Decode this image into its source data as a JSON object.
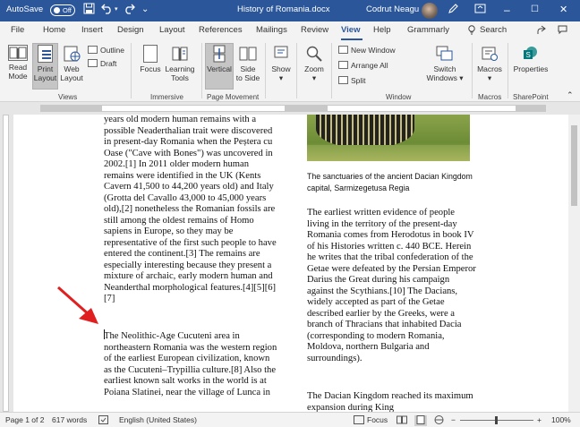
{
  "titlebar": {
    "autosave_label": "AutoSave",
    "autosave_state": "Off",
    "document_title": "History of Romania.docx",
    "user_name": "Codrut Neagu",
    "save_icon": "save-icon",
    "undo_icon": "undo-icon",
    "redo_icon": "redo-icon",
    "minimize": "–",
    "maximize": "☐",
    "close": "✕"
  },
  "tabs": [
    "File",
    "Home",
    "Insert",
    "Design",
    "Layout",
    "References",
    "Mailings",
    "Review",
    "View",
    "Help",
    "Grammarly"
  ],
  "active_tab": "View",
  "search_label": "Search",
  "ribbon": {
    "views": {
      "group": "Views",
      "read_mode": [
        "Read",
        "Mode"
      ],
      "print_layout": [
        "Print",
        "Layout"
      ],
      "web_layout": [
        "Web",
        "Layout"
      ],
      "outline": "Outline",
      "draft": "Draft"
    },
    "immersive": {
      "group": "Immersive",
      "focus": "Focus",
      "learning_tools": [
        "Learning",
        "Tools"
      ]
    },
    "page_movement": {
      "group": "Page Movement",
      "vertical": "Vertical",
      "side_to_side": [
        "Side",
        "to Side"
      ]
    },
    "show": "Show",
    "zoom": "Zoom",
    "window": {
      "group": "Window",
      "new_window": "New Window",
      "arrange_all": "Arrange All",
      "split": "Split",
      "switch_windows": [
        "Switch",
        "Windows ▾"
      ]
    },
    "macros": {
      "group": "Macros",
      "label": "Macros"
    },
    "sharepoint": {
      "group": "SharePoint",
      "label": "Properties"
    }
  },
  "document": {
    "left_col_top": "years old modern human remains with a possible Neaderthalian trait were discovered in present-day Romania when the Peștera cu Oase (\"Cave with Bones\") was uncovered in 2002.[1] In 2011 older modern human remains were identified in the UK (Kents Cavern 41,500 to 44,200 years old) and Italy (Grotta del Cavallo 43,000 to 45,000 years old),[2] nonetheless the Romanian fossils are still among the oldest remains of Homo sapiens in Europe, so they may be representative of the first such people to have entered the continent.[3] The remains are especially interesting because they present a mixture of archaic, early modern human and Neanderthal morphological features.[4][5][6][7]",
    "left_col_bottom": "The Neolithic-Age Cucuteni area in northeastern Romania was the western region of the earliest European civilization, known as the Cucuteni–Trypillia culture.[8] Also the earliest known salt works in the world is at Poiana Slatinei, near the village of Lunca in",
    "caption": "The sanctuaries of the ancient Dacian Kingdom capital, Sarmizegetusa Regia",
    "right_col_para1": "The earliest written evidence of people living in the territory of the present-day Romania comes from Herodotus in book IV of his Histories written c. 440 BCE. Herein he writes that the tribal confederation of the Getae were defeated by the Persian Emperor Darius the Great during his campaign against the Scythians.[10] The Dacians, widely accepted as part of the Getae described earlier by the Greeks, were a branch of Thracians that inhabited Dacia (corresponding to modern Romania, Moldova, northern Bulgaria and surroundings).",
    "right_col_para2": "The Dacian Kingdom reached its maximum expansion during King"
  },
  "status": {
    "page": "Page 1 of 2",
    "words": "617 words",
    "language": "English (United States)",
    "focus": "Focus",
    "zoom_level": "100%",
    "zoom_minus": "−",
    "zoom_plus": "+"
  },
  "colors": {
    "accent": "#2b579a",
    "arrow": "#e02020"
  }
}
